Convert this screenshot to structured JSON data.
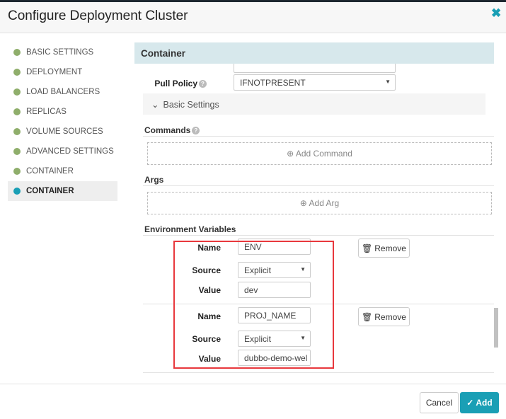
{
  "dialog": {
    "title": "Configure Deployment Cluster",
    "close_icon": "close-icon"
  },
  "sidebar": {
    "items": [
      {
        "label": "BASIC SETTINGS",
        "status": "complete"
      },
      {
        "label": "DEPLOYMENT",
        "status": "complete"
      },
      {
        "label": "LOAD BALANCERS",
        "status": "complete"
      },
      {
        "label": "REPLICAS",
        "status": "complete"
      },
      {
        "label": "VOLUME SOURCES",
        "status": "complete"
      },
      {
        "label": "ADVANCED SETTINGS",
        "status": "complete"
      },
      {
        "label": "CONTAINER",
        "status": "complete"
      },
      {
        "label": "CONTAINER",
        "status": "active"
      }
    ]
  },
  "section": {
    "title": "Container",
    "pull_policy": {
      "label": "Pull Policy",
      "value": "IFNOTPRESENT"
    },
    "basic_settings": "Basic Settings",
    "commands": {
      "label": "Commands",
      "add": "Add Command"
    },
    "args": {
      "label": "Args",
      "add": "Add Arg"
    },
    "env": {
      "label": "Environment Variables",
      "name_label": "Name",
      "source_label": "Source",
      "value_label": "Value",
      "remove": "Remove",
      "rows": [
        {
          "name": "ENV",
          "source": "Explicit",
          "value": "dev"
        },
        {
          "name": "PROJ_NAME",
          "source": "Explicit",
          "value": "dubbo-demo-wel"
        }
      ]
    }
  },
  "footer": {
    "cancel": "Cancel",
    "add": "Add"
  },
  "colors": {
    "accent": "#1a9fb5",
    "complete": "#8fae6b",
    "highlight": "#e8383d"
  }
}
